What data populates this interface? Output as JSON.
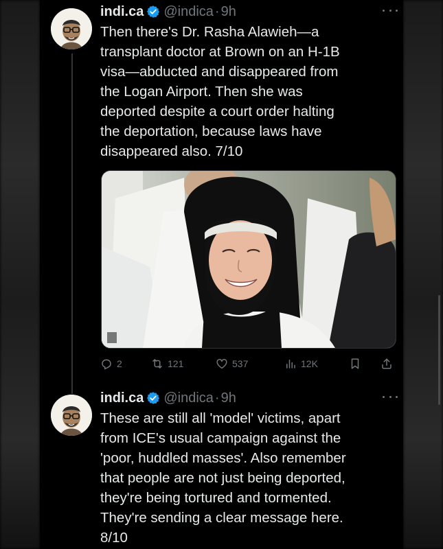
{
  "colors": {
    "background": "#000000",
    "text": "#e7e9ea",
    "muted": "#71767b",
    "verified": "#1d9bf0"
  },
  "tweets": [
    {
      "display_name": "indi.ca",
      "handle": "@indica",
      "separator": "·",
      "time": "9h",
      "text": "Then there's Dr. Rasha Alawieh—a\ntransplant doctor at Brown on an H-1B\nvisa—abducted and disappeared from\nthe Logan Airport. Then she was\ndeported despite a court order halting\nthe deportation, because laws have\ndisappeared also. 7/10",
      "has_media": true,
      "actions": {
        "replies": "2",
        "retweets": "121",
        "likes": "537",
        "views": "12K"
      }
    },
    {
      "display_name": "indi.ca",
      "handle": "@indica",
      "separator": "·",
      "time": "9h",
      "text": "These are still all 'model' victims, apart\nfrom ICE's usual campaign against the\n'poor, huddled masses'. Also remember\nthat people are not just being deported,\nthey're being tortured and tormented.\nThey're sending a clear message here.\n8/10"
    }
  ],
  "icons": {
    "verified": "verified-badge-icon",
    "more": "more-options-icon",
    "reply": "reply-icon",
    "retweet": "retweet-icon",
    "like": "heart-icon",
    "views": "views-icon",
    "bookmark": "bookmark-icon",
    "share": "share-icon"
  }
}
